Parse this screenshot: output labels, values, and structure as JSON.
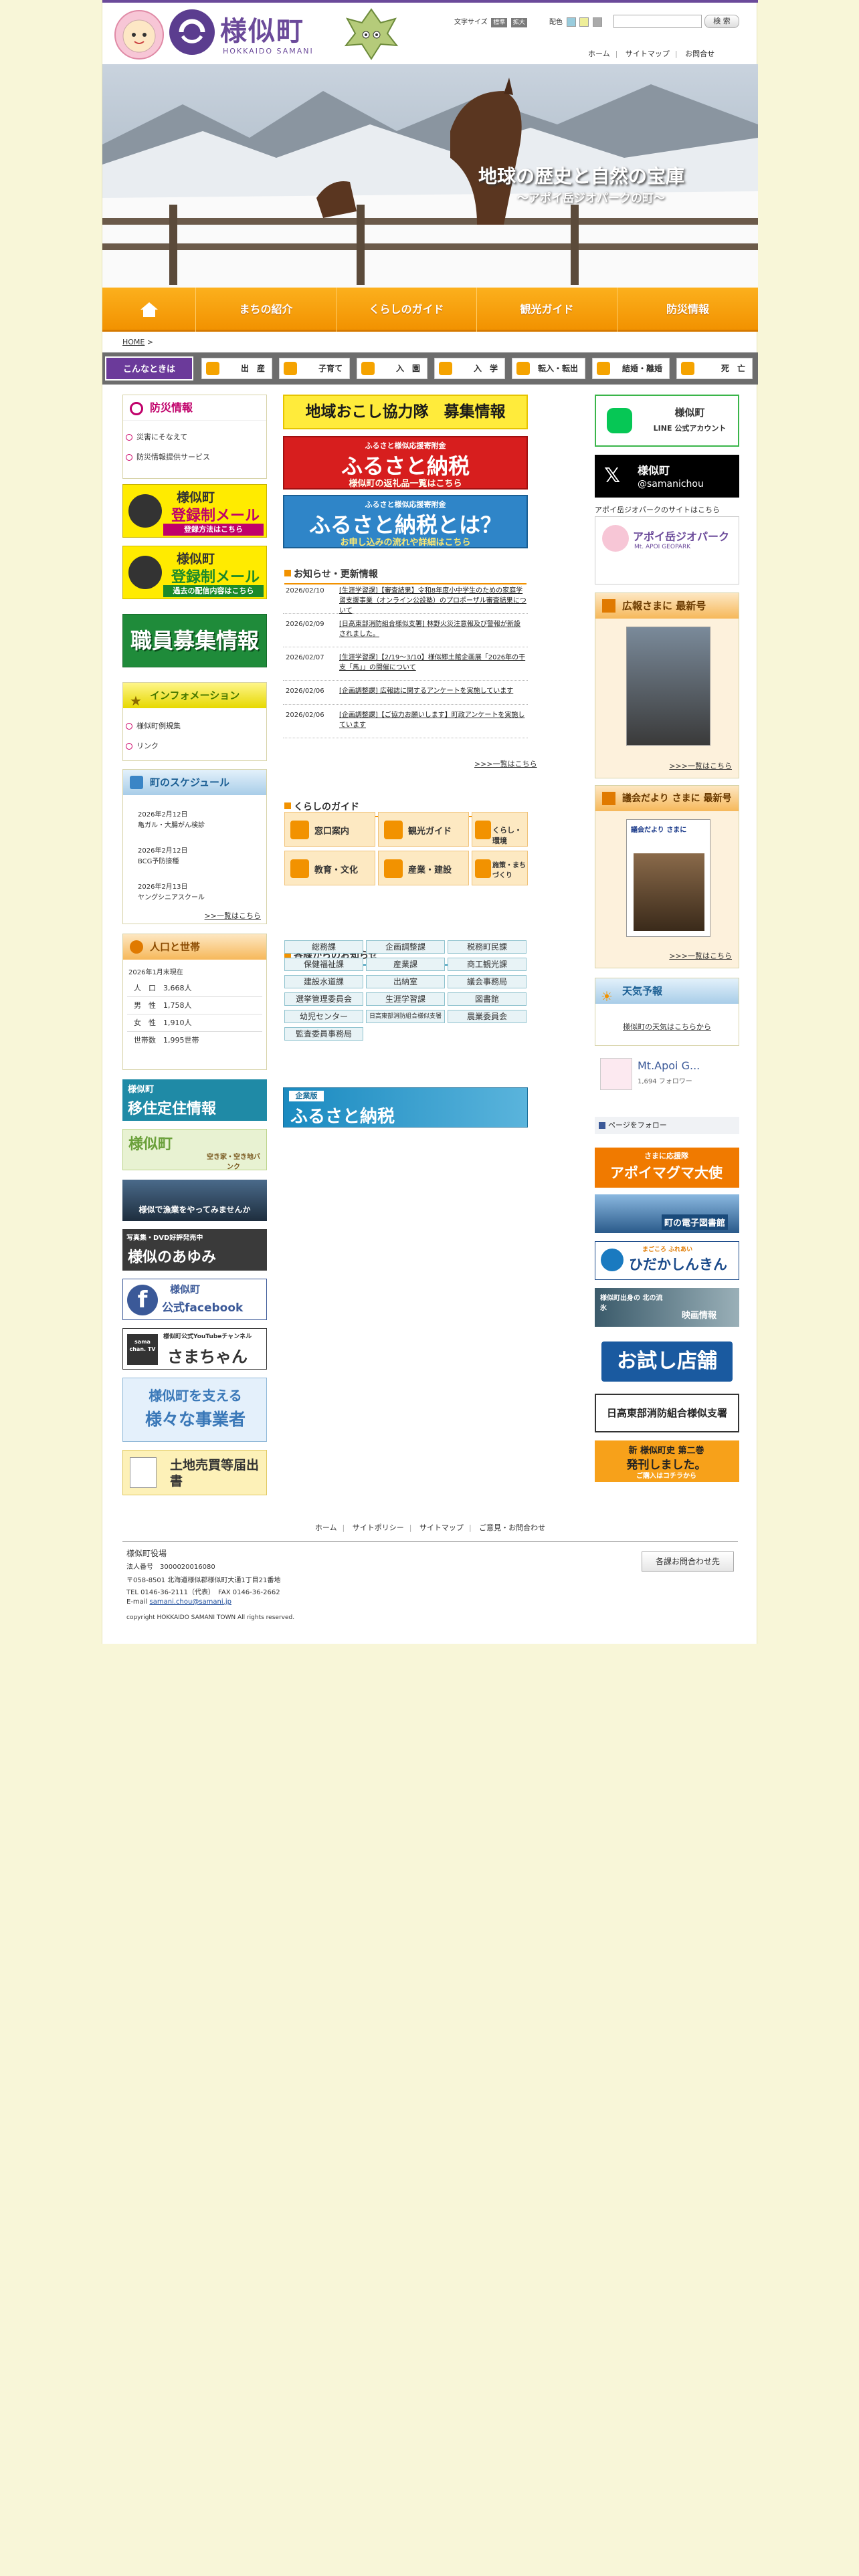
{
  "header": {
    "town_name": "様似町",
    "town_name_en": "HOKKAIDO SAMANI",
    "font_size_label": "文字サイズ",
    "font_size_small": "標準",
    "font_size_large": "拡大",
    "color_label": "配色",
    "search_button": "検 索",
    "links": [
      "ホーム",
      "サイトマップ",
      "お問合せ"
    ]
  },
  "hero": {
    "title": "地球の歴史と自然の宝庫",
    "subtitle": "～アポイ岳ジオパークの町～"
  },
  "gnav": {
    "items": [
      "home-icon",
      "まちの紹介",
      "くらしのガイド",
      "観光ガイド",
      "防災情報"
    ]
  },
  "breadcrumb": {
    "home": "HOME",
    "sep": ">"
  },
  "life": {
    "label": "こんなときは",
    "items": [
      "出　産",
      "子育て",
      "入　園",
      "入　学",
      "転入・転出",
      "結婚・離婚",
      "死　亡"
    ]
  },
  "left": {
    "bousai": {
      "title": "防災情報",
      "items": [
        "災害にそなえて",
        "防災情報提供サービス"
      ]
    },
    "mail1": {
      "line1": "様似町",
      "line2": "登録制メール",
      "line3": "登録方法はこちら"
    },
    "mail2": {
      "line1": "様似町",
      "line2": "登録制メール",
      "line3": "過去の配信内容はこちら"
    },
    "recruit": {
      "text": "職員募集情報"
    },
    "info": {
      "title": "インフォメーション",
      "items": [
        "様似町例規集",
        "リンク"
      ]
    },
    "schedule": {
      "title": "町のスケジュール",
      "items": [
        {
          "date": "2026年2月12日",
          "text": "亀ガル・大腸がん検診"
        },
        {
          "date": "2026年2月12日",
          "text": "BCG予防接種"
        },
        {
          "date": "2026年2月13日",
          "text": "ヤングシニアスクール"
        }
      ],
      "more": ">>一覧はこちら"
    },
    "population": {
      "title": "人口と世帯",
      "as_of": "2026年1月末現在",
      "rows": [
        {
          "label": "人　口",
          "value": "3,668人"
        },
        {
          "label": "男　性",
          "value": "1,758人"
        },
        {
          "label": "女　性",
          "value": "1,910人"
        },
        {
          "label": "世帯数",
          "value": "1,995世帯"
        }
      ]
    },
    "banners": {
      "migrate": "移住定住情報",
      "migrate_top": "様似町",
      "akiya": "空き家・空き地バンク",
      "akiya_top": "様似町",
      "fishery": "様似で漁業をやってみませんか",
      "dvd_top": "写真集・DVD好評発売中",
      "dvd": "様似のあゆみ",
      "facebook_top": "様似町",
      "facebook": "公式facebook",
      "youtube_small": "様似町公式YouTubeチャンネル",
      "youtube": "さまちゃん",
      "youtube_logo": "sama chan. TV",
      "business_top": "様似町を支える",
      "business": "様々な事業者",
      "land": "土地売買等届出書"
    }
  },
  "center": {
    "kyoryoku": "地域おこし協力隊　募集情報",
    "furusato1_small": "ふるさと様似応援寄附金",
    "furusato1": "ふるさと納税",
    "furusato1_sub": "様似町の返礼品一覧はこちら",
    "furusato2_small": "ふるさと様似応援寄附金",
    "furusato2": "ふるさと納税とは？",
    "furusato2_sub": "お申し込みの流れや詳細はこちら",
    "news_title": "お知らせ・更新情報",
    "news": [
      {
        "date": "2026/02/10",
        "text": "[生涯学習課]【審査結果】令和8年度小中学生のための家庭学習支援事業（オンライン公設塾）のプロポーザル審査結果について"
      },
      {
        "date": "2026/02/09",
        "text": "[日高東部消防組合様似支署] 林野火災注意報及び警報が新設されました。"
      },
      {
        "date": "2026/02/07",
        "text": "[生涯学習課]【2/19〜3/10】様似郷土館企画展「2026年の干支「馬」」の開催について"
      },
      {
        "date": "2026/02/06",
        "text": "[企画調整課] 広報誌に関するアンケートを実施しています"
      },
      {
        "date": "2026/02/06",
        "text": "[企画調整課]【ご協力お願いします】町政アンケートを実施しています"
      }
    ],
    "news_more": ">>>一覧はこちら",
    "guide_title": "くらしのガイド",
    "guide": [
      "窓口案内",
      "観光ガイド",
      "くらし・環境",
      "教育・文化",
      "産業・建設",
      "施策・まちづくり"
    ],
    "dept_title": "各課からのお知らせ",
    "depts": [
      "総務課",
      "企画調整課",
      "税務町民課",
      "保健福祉課",
      "産業課",
      "商工観光課",
      "建設水道課",
      "出納室",
      "議会事務局",
      "選挙管理委員会",
      "生涯学習課",
      "図書館",
      "幼児センター",
      "日高東部消防組合様似支署",
      "農業委員会",
      "監査委員事務局"
    ],
    "furusato_wide_small": "企業版",
    "furusato_wide": "ふるさと納税"
  },
  "right": {
    "line_title": "様似町",
    "line_sub": "LINE 公式アカウント",
    "x_name": "様似町",
    "x_handle": "@samanichou",
    "apoi_caption": "アポイ岳ジオパークのサイトはこちら",
    "apoi_logo": "アポイ岳ジオパーク",
    "apoi_logo_en": "Mt. APOI GEOPARK",
    "koho_title": "広報さまに 最新号",
    "koho_more": ">>>一覧はこちら",
    "gikai_title": "議会だより さまに 最新号",
    "gikai_cover": "議会だより さまに",
    "gikai_more": ">>>一覧はこちら",
    "weather_title": "天気予報",
    "weather_link": "様似町の天気はこちらから",
    "fb_name": "Mt.Apoi G...",
    "fb_followers": "1,694 フォロワー",
    "fb_follow": "ページをフォロー",
    "banners": {
      "apoimagma_small": "さまに応援隊",
      "apoimagma": "アポイマグマ大使",
      "library": "町の電子図書館",
      "shinkin_small": "まごころ ふれあい",
      "shinkin": "ひだかしんきん",
      "eiga_small": "様似町出身の 北の流氷",
      "eiga": "映画情報",
      "otameshi": "お試し店舗",
      "shobo": "日高東部消防組合様似支署",
      "chosi_top": "新 様似町史 第二巻",
      "chosi": "発刊しました。",
      "chosi_sub": "ご購入はコチラから"
    }
  },
  "footer": {
    "links": [
      "ホーム",
      "サイトポリシー",
      "サイトマップ",
      "ご意見・お問合わせ"
    ],
    "office": "様似町役場",
    "corp_no": "法人番号　3000020016080",
    "address": "〒058-8501 北海道様似郡様似町大通1丁目21番地",
    "tel": "TEL 0146-36-2111（代表）　FAX 0146-36-2662",
    "email_label": "E-mail",
    "email": "samani.chou@samani.jp",
    "copyright": "copyright HOKKAIDO SAMANI TOWN All rights reserved.",
    "contact_button": "各課お問合わせ先"
  },
  "colors": {
    "accent": "#f29200",
    "brand": "#6b4a9a",
    "bg": "#f8f6d8"
  }
}
